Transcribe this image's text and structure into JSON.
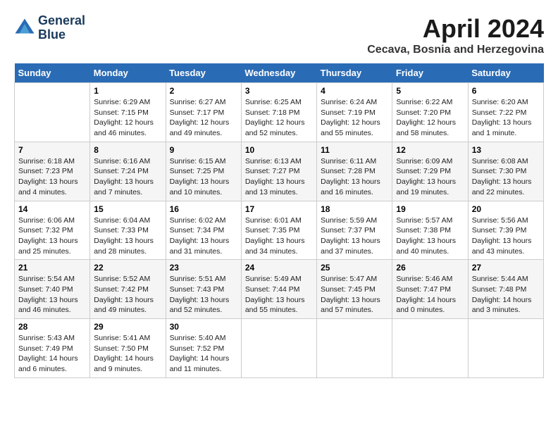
{
  "header": {
    "logo_line1": "General",
    "logo_line2": "Blue",
    "month_title": "April 2024",
    "location": "Cecava, Bosnia and Herzegovina"
  },
  "weekdays": [
    "Sunday",
    "Monday",
    "Tuesday",
    "Wednesday",
    "Thursday",
    "Friday",
    "Saturday"
  ],
  "weeks": [
    [
      {
        "day": "",
        "sunrise": "",
        "sunset": "",
        "daylight": ""
      },
      {
        "day": "1",
        "sunrise": "Sunrise: 6:29 AM",
        "sunset": "Sunset: 7:15 PM",
        "daylight": "Daylight: 12 hours and 46 minutes."
      },
      {
        "day": "2",
        "sunrise": "Sunrise: 6:27 AM",
        "sunset": "Sunset: 7:17 PM",
        "daylight": "Daylight: 12 hours and 49 minutes."
      },
      {
        "day": "3",
        "sunrise": "Sunrise: 6:25 AM",
        "sunset": "Sunset: 7:18 PM",
        "daylight": "Daylight: 12 hours and 52 minutes."
      },
      {
        "day": "4",
        "sunrise": "Sunrise: 6:24 AM",
        "sunset": "Sunset: 7:19 PM",
        "daylight": "Daylight: 12 hours and 55 minutes."
      },
      {
        "day": "5",
        "sunrise": "Sunrise: 6:22 AM",
        "sunset": "Sunset: 7:20 PM",
        "daylight": "Daylight: 12 hours and 58 minutes."
      },
      {
        "day": "6",
        "sunrise": "Sunrise: 6:20 AM",
        "sunset": "Sunset: 7:22 PM",
        "daylight": "Daylight: 13 hours and 1 minute."
      }
    ],
    [
      {
        "day": "7",
        "sunrise": "Sunrise: 6:18 AM",
        "sunset": "Sunset: 7:23 PM",
        "daylight": "Daylight: 13 hours and 4 minutes."
      },
      {
        "day": "8",
        "sunrise": "Sunrise: 6:16 AM",
        "sunset": "Sunset: 7:24 PM",
        "daylight": "Daylight: 13 hours and 7 minutes."
      },
      {
        "day": "9",
        "sunrise": "Sunrise: 6:15 AM",
        "sunset": "Sunset: 7:25 PM",
        "daylight": "Daylight: 13 hours and 10 minutes."
      },
      {
        "day": "10",
        "sunrise": "Sunrise: 6:13 AM",
        "sunset": "Sunset: 7:27 PM",
        "daylight": "Daylight: 13 hours and 13 minutes."
      },
      {
        "day": "11",
        "sunrise": "Sunrise: 6:11 AM",
        "sunset": "Sunset: 7:28 PM",
        "daylight": "Daylight: 13 hours and 16 minutes."
      },
      {
        "day": "12",
        "sunrise": "Sunrise: 6:09 AM",
        "sunset": "Sunset: 7:29 PM",
        "daylight": "Daylight: 13 hours and 19 minutes."
      },
      {
        "day": "13",
        "sunrise": "Sunrise: 6:08 AM",
        "sunset": "Sunset: 7:30 PM",
        "daylight": "Daylight: 13 hours and 22 minutes."
      }
    ],
    [
      {
        "day": "14",
        "sunrise": "Sunrise: 6:06 AM",
        "sunset": "Sunset: 7:32 PM",
        "daylight": "Daylight: 13 hours and 25 minutes."
      },
      {
        "day": "15",
        "sunrise": "Sunrise: 6:04 AM",
        "sunset": "Sunset: 7:33 PM",
        "daylight": "Daylight: 13 hours and 28 minutes."
      },
      {
        "day": "16",
        "sunrise": "Sunrise: 6:02 AM",
        "sunset": "Sunset: 7:34 PM",
        "daylight": "Daylight: 13 hours and 31 minutes."
      },
      {
        "day": "17",
        "sunrise": "Sunrise: 6:01 AM",
        "sunset": "Sunset: 7:35 PM",
        "daylight": "Daylight: 13 hours and 34 minutes."
      },
      {
        "day": "18",
        "sunrise": "Sunrise: 5:59 AM",
        "sunset": "Sunset: 7:37 PM",
        "daylight": "Daylight: 13 hours and 37 minutes."
      },
      {
        "day": "19",
        "sunrise": "Sunrise: 5:57 AM",
        "sunset": "Sunset: 7:38 PM",
        "daylight": "Daylight: 13 hours and 40 minutes."
      },
      {
        "day": "20",
        "sunrise": "Sunrise: 5:56 AM",
        "sunset": "Sunset: 7:39 PM",
        "daylight": "Daylight: 13 hours and 43 minutes."
      }
    ],
    [
      {
        "day": "21",
        "sunrise": "Sunrise: 5:54 AM",
        "sunset": "Sunset: 7:40 PM",
        "daylight": "Daylight: 13 hours and 46 minutes."
      },
      {
        "day": "22",
        "sunrise": "Sunrise: 5:52 AM",
        "sunset": "Sunset: 7:42 PM",
        "daylight": "Daylight: 13 hours and 49 minutes."
      },
      {
        "day": "23",
        "sunrise": "Sunrise: 5:51 AM",
        "sunset": "Sunset: 7:43 PM",
        "daylight": "Daylight: 13 hours and 52 minutes."
      },
      {
        "day": "24",
        "sunrise": "Sunrise: 5:49 AM",
        "sunset": "Sunset: 7:44 PM",
        "daylight": "Daylight: 13 hours and 55 minutes."
      },
      {
        "day": "25",
        "sunrise": "Sunrise: 5:47 AM",
        "sunset": "Sunset: 7:45 PM",
        "daylight": "Daylight: 13 hours and 57 minutes."
      },
      {
        "day": "26",
        "sunrise": "Sunrise: 5:46 AM",
        "sunset": "Sunset: 7:47 PM",
        "daylight": "Daylight: 14 hours and 0 minutes."
      },
      {
        "day": "27",
        "sunrise": "Sunrise: 5:44 AM",
        "sunset": "Sunset: 7:48 PM",
        "daylight": "Daylight: 14 hours and 3 minutes."
      }
    ],
    [
      {
        "day": "28",
        "sunrise": "Sunrise: 5:43 AM",
        "sunset": "Sunset: 7:49 PM",
        "daylight": "Daylight: 14 hours and 6 minutes."
      },
      {
        "day": "29",
        "sunrise": "Sunrise: 5:41 AM",
        "sunset": "Sunset: 7:50 PM",
        "daylight": "Daylight: 14 hours and 9 minutes."
      },
      {
        "day": "30",
        "sunrise": "Sunrise: 5:40 AM",
        "sunset": "Sunset: 7:52 PM",
        "daylight": "Daylight: 14 hours and 11 minutes."
      },
      {
        "day": "",
        "sunrise": "",
        "sunset": "",
        "daylight": ""
      },
      {
        "day": "",
        "sunrise": "",
        "sunset": "",
        "daylight": ""
      },
      {
        "day": "",
        "sunrise": "",
        "sunset": "",
        "daylight": ""
      },
      {
        "day": "",
        "sunrise": "",
        "sunset": "",
        "daylight": ""
      }
    ]
  ]
}
